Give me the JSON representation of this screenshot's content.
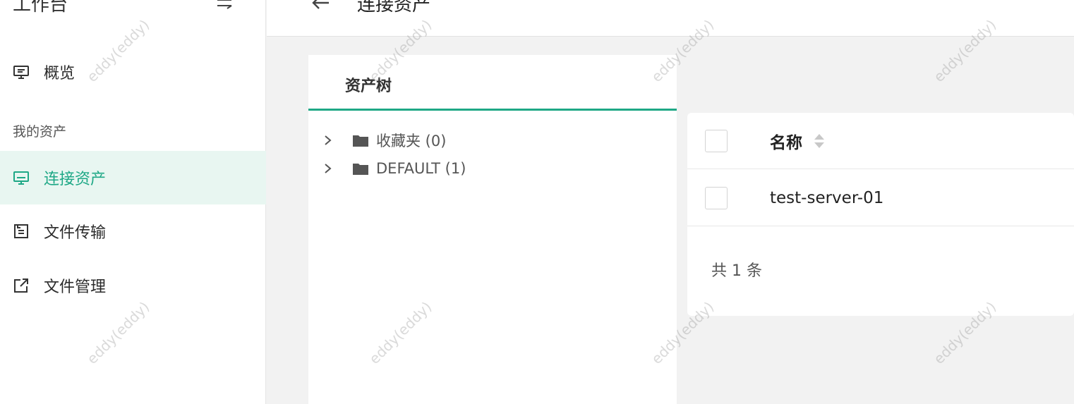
{
  "sidebar": {
    "title": "工作台",
    "items": [
      {
        "label": "概览",
        "icon": "monitor-icon"
      },
      {
        "label": "连接资产",
        "icon": "desktop-connect-icon"
      },
      {
        "label": "文件传输",
        "icon": "file-transfer-icon"
      },
      {
        "label": "文件管理",
        "icon": "external-link-icon"
      }
    ],
    "group_label": "我的资产"
  },
  "header": {
    "title": "连接资产"
  },
  "tree": {
    "tab_label": "资产树",
    "nodes": [
      {
        "label": "收藏夹 (0)"
      },
      {
        "label": "DEFAULT (1)"
      }
    ]
  },
  "table": {
    "columns": [
      "名称"
    ],
    "rows": [
      {
        "name": "test-server-01"
      }
    ],
    "total_text": "共 1 条"
  },
  "watermark": "eddy(eddy)",
  "colors": {
    "accent": "#1ea886",
    "active_bg": "#e8f6f1"
  }
}
